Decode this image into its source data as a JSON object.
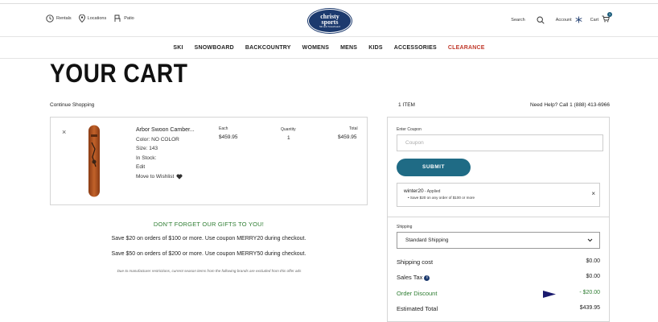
{
  "header": {
    "rentals": "Rentals",
    "locations": "Locations",
    "patio": "Patio",
    "logo_line1": "christy",
    "logo_line2": "sports",
    "logo_line3": "Ski and Snowboard",
    "search": "Search",
    "account": "Account",
    "cart": "Cart",
    "cart_count": "1"
  },
  "nav": {
    "items": [
      "SKI",
      "SNOWBOARD",
      "BACKCOUNTRY",
      "WOMENS",
      "MENS",
      "KIDS",
      "ACCESSORIES",
      "CLEARANCE"
    ]
  },
  "page": {
    "title": "YOUR CART",
    "continue_shopping": "Continue Shopping",
    "item_count": "1 ITEM",
    "help": "Need Help? Call 1 (888) 413-6966"
  },
  "cart_item": {
    "name": "Arbor Swoon Camber...",
    "color": "Color: NO COLOR",
    "size": "Size: 143",
    "stock": "In Stock:",
    "edit": "Edit",
    "wishlist": "Move to Wishlist",
    "each_label": "Each",
    "each_value": "$459.95",
    "qty_label": "Quantity",
    "qty_value": "1",
    "total_label": "Total",
    "total_value": "$459.95"
  },
  "promo": {
    "title": "DON'T FORGET OUR GIFTS TO YOU!",
    "line1": "Save $20 on orders of $100 or more.  Use coupon MERRY20 during checkout.",
    "line2": "Save $50 on orders of $200 or more.  Use coupon MERRY50 during checkout.",
    "note": "Due to manufacturer restrictions, current season items from the following brands are excluded from this offer ads"
  },
  "summary": {
    "coupon_label": "Enter Coupon",
    "coupon_placeholder": "Coupon",
    "submit": "SUBMIT",
    "applied_code": "winter20",
    "applied_status": " - Applied",
    "applied_desc": "Save $20 on any order of $100 or more",
    "shipping_label": "Shipping",
    "shipping_option": "Standard Shipping",
    "shipping_cost_label": "Shipping cost",
    "shipping_cost": "$0.00",
    "sales_tax_label": "Sales Tax",
    "sales_tax": "$0.00",
    "discount_label": "Order Discount",
    "discount": "- $20.00",
    "estimated_label": "Estimated Total",
    "estimated": "$439.95"
  },
  "colors": {
    "brand_navy": "#1c3a6e",
    "submit_teal": "#1f6b85",
    "clearance_red": "#c0392b",
    "discount_green": "#2e7d32"
  }
}
